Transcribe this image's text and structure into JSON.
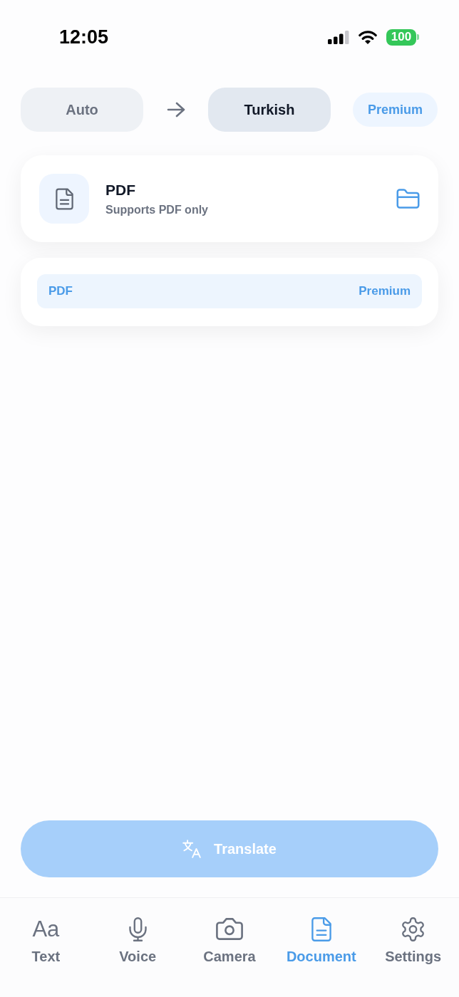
{
  "status_bar": {
    "time": "12:05",
    "battery": "100"
  },
  "languages": {
    "source": "Auto",
    "target": "Turkish",
    "premium": "Premium"
  },
  "upload_card": {
    "title": "PDF",
    "subtitle": "Supports PDF only"
  },
  "formats": [
    {
      "name": "PDF",
      "badge": "Premium",
      "selected": true
    }
  ],
  "translate_button": {
    "label": "Translate",
    "disabled": true
  },
  "tabs": [
    {
      "kind": "text",
      "glyph": "Aa",
      "label": "Text",
      "selected": false
    },
    {
      "kind": "voice",
      "label": "Voice",
      "selected": false
    },
    {
      "kind": "camera",
      "label": "Camera",
      "selected": false
    },
    {
      "kind": "document",
      "label": "Document",
      "selected": true
    },
    {
      "kind": "settings",
      "label": "Settings",
      "selected": false
    }
  ]
}
